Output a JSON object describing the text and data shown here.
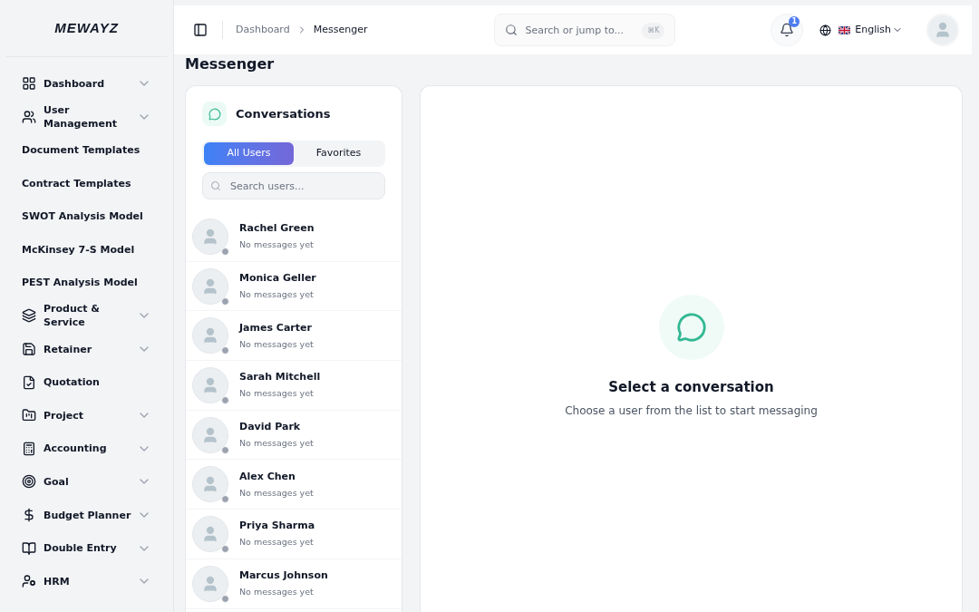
{
  "logo": "MEWAYZ",
  "sidebar": {
    "items": [
      {
        "label": "Dashboard",
        "kind": "menu"
      },
      {
        "label": "User Management",
        "kind": "menu"
      },
      {
        "label": "Document Templates",
        "kind": "template"
      },
      {
        "label": "Contract Templates",
        "kind": "template"
      },
      {
        "label": "SWOT Analysis Model",
        "kind": "template"
      },
      {
        "label": "McKinsey 7-S Model",
        "kind": "template"
      },
      {
        "label": "PEST Analysis Model",
        "kind": "template"
      },
      {
        "label": "Product & Service",
        "kind": "menu"
      },
      {
        "label": "Retainer",
        "kind": "menu"
      },
      {
        "label": "Quotation",
        "kind": "page"
      },
      {
        "label": "Project",
        "kind": "menu"
      },
      {
        "label": "Accounting",
        "kind": "menu"
      },
      {
        "label": "Goal",
        "kind": "menu"
      },
      {
        "label": "Budget Planner",
        "kind": "menu"
      },
      {
        "label": "Double Entry",
        "kind": "menu"
      },
      {
        "label": "HRM",
        "kind": "menu"
      }
    ]
  },
  "header": {
    "breadcrumbs": [
      "Dashboard",
      "Messenger"
    ],
    "search": {
      "placeholder": "Search or jump to...",
      "shortcut": "⌘K"
    },
    "notifications": "1",
    "language": "English"
  },
  "page_title": "Messenger",
  "conversations": {
    "title": "Conversations",
    "tabs": [
      {
        "label": "All Users",
        "selected": true
      },
      {
        "label": "Favorites",
        "selected": false
      }
    ],
    "search": {
      "placeholder": "Search users..."
    },
    "users": [
      {
        "name": "Rachel Green",
        "preview": "No messages yet",
        "online": false
      },
      {
        "name": "Monica Geller",
        "preview": "No messages yet",
        "online": false
      },
      {
        "name": "James Carter",
        "preview": "No messages yet",
        "online": false
      },
      {
        "name": "Sarah Mitchell",
        "preview": "No messages yet",
        "online": false
      },
      {
        "name": "David Park",
        "preview": "No messages yet",
        "online": false
      },
      {
        "name": "Alex Chen",
        "preview": "No messages yet",
        "online": false
      },
      {
        "name": "Priya Sharma",
        "preview": "No messages yet",
        "online": false
      },
      {
        "name": "Marcus Johnson",
        "preview": "No messages yet",
        "online": false
      }
    ]
  },
  "empty_state": {
    "title": "Select a conversation",
    "text": "Choose a user from the list to start messaging"
  }
}
